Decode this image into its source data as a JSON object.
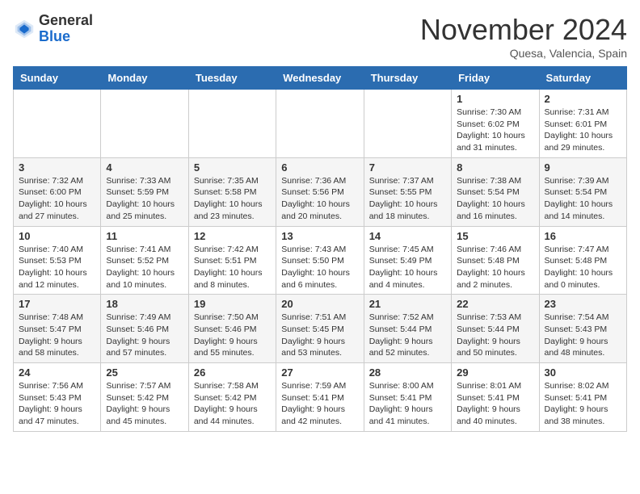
{
  "header": {
    "logo_general": "General",
    "logo_blue": "Blue",
    "month_title": "November 2024",
    "location": "Quesa, Valencia, Spain"
  },
  "days_of_week": [
    "Sunday",
    "Monday",
    "Tuesday",
    "Wednesday",
    "Thursday",
    "Friday",
    "Saturday"
  ],
  "weeks": [
    [
      {
        "day": "",
        "info": ""
      },
      {
        "day": "",
        "info": ""
      },
      {
        "day": "",
        "info": ""
      },
      {
        "day": "",
        "info": ""
      },
      {
        "day": "",
        "info": ""
      },
      {
        "day": "1",
        "info": "Sunrise: 7:30 AM\nSunset: 6:02 PM\nDaylight: 10 hours\nand 31 minutes."
      },
      {
        "day": "2",
        "info": "Sunrise: 7:31 AM\nSunset: 6:01 PM\nDaylight: 10 hours\nand 29 minutes."
      }
    ],
    [
      {
        "day": "3",
        "info": "Sunrise: 7:32 AM\nSunset: 6:00 PM\nDaylight: 10 hours\nand 27 minutes."
      },
      {
        "day": "4",
        "info": "Sunrise: 7:33 AM\nSunset: 5:59 PM\nDaylight: 10 hours\nand 25 minutes."
      },
      {
        "day": "5",
        "info": "Sunrise: 7:35 AM\nSunset: 5:58 PM\nDaylight: 10 hours\nand 23 minutes."
      },
      {
        "day": "6",
        "info": "Sunrise: 7:36 AM\nSunset: 5:56 PM\nDaylight: 10 hours\nand 20 minutes."
      },
      {
        "day": "7",
        "info": "Sunrise: 7:37 AM\nSunset: 5:55 PM\nDaylight: 10 hours\nand 18 minutes."
      },
      {
        "day": "8",
        "info": "Sunrise: 7:38 AM\nSunset: 5:54 PM\nDaylight: 10 hours\nand 16 minutes."
      },
      {
        "day": "9",
        "info": "Sunrise: 7:39 AM\nSunset: 5:54 PM\nDaylight: 10 hours\nand 14 minutes."
      }
    ],
    [
      {
        "day": "10",
        "info": "Sunrise: 7:40 AM\nSunset: 5:53 PM\nDaylight: 10 hours\nand 12 minutes."
      },
      {
        "day": "11",
        "info": "Sunrise: 7:41 AM\nSunset: 5:52 PM\nDaylight: 10 hours\nand 10 minutes."
      },
      {
        "day": "12",
        "info": "Sunrise: 7:42 AM\nSunset: 5:51 PM\nDaylight: 10 hours\nand 8 minutes."
      },
      {
        "day": "13",
        "info": "Sunrise: 7:43 AM\nSunset: 5:50 PM\nDaylight: 10 hours\nand 6 minutes."
      },
      {
        "day": "14",
        "info": "Sunrise: 7:45 AM\nSunset: 5:49 PM\nDaylight: 10 hours\nand 4 minutes."
      },
      {
        "day": "15",
        "info": "Sunrise: 7:46 AM\nSunset: 5:48 PM\nDaylight: 10 hours\nand 2 minutes."
      },
      {
        "day": "16",
        "info": "Sunrise: 7:47 AM\nSunset: 5:48 PM\nDaylight: 10 hours\nand 0 minutes."
      }
    ],
    [
      {
        "day": "17",
        "info": "Sunrise: 7:48 AM\nSunset: 5:47 PM\nDaylight: 9 hours\nand 58 minutes."
      },
      {
        "day": "18",
        "info": "Sunrise: 7:49 AM\nSunset: 5:46 PM\nDaylight: 9 hours\nand 57 minutes."
      },
      {
        "day": "19",
        "info": "Sunrise: 7:50 AM\nSunset: 5:46 PM\nDaylight: 9 hours\nand 55 minutes."
      },
      {
        "day": "20",
        "info": "Sunrise: 7:51 AM\nSunset: 5:45 PM\nDaylight: 9 hours\nand 53 minutes."
      },
      {
        "day": "21",
        "info": "Sunrise: 7:52 AM\nSunset: 5:44 PM\nDaylight: 9 hours\nand 52 minutes."
      },
      {
        "day": "22",
        "info": "Sunrise: 7:53 AM\nSunset: 5:44 PM\nDaylight: 9 hours\nand 50 minutes."
      },
      {
        "day": "23",
        "info": "Sunrise: 7:54 AM\nSunset: 5:43 PM\nDaylight: 9 hours\nand 48 minutes."
      }
    ],
    [
      {
        "day": "24",
        "info": "Sunrise: 7:56 AM\nSunset: 5:43 PM\nDaylight: 9 hours\nand 47 minutes."
      },
      {
        "day": "25",
        "info": "Sunrise: 7:57 AM\nSunset: 5:42 PM\nDaylight: 9 hours\nand 45 minutes."
      },
      {
        "day": "26",
        "info": "Sunrise: 7:58 AM\nSunset: 5:42 PM\nDaylight: 9 hours\nand 44 minutes."
      },
      {
        "day": "27",
        "info": "Sunrise: 7:59 AM\nSunset: 5:41 PM\nDaylight: 9 hours\nand 42 minutes."
      },
      {
        "day": "28",
        "info": "Sunrise: 8:00 AM\nSunset: 5:41 PM\nDaylight: 9 hours\nand 41 minutes."
      },
      {
        "day": "29",
        "info": "Sunrise: 8:01 AM\nSunset: 5:41 PM\nDaylight: 9 hours\nand 40 minutes."
      },
      {
        "day": "30",
        "info": "Sunrise: 8:02 AM\nSunset: 5:41 PM\nDaylight: 9 hours\nand 38 minutes."
      }
    ]
  ]
}
